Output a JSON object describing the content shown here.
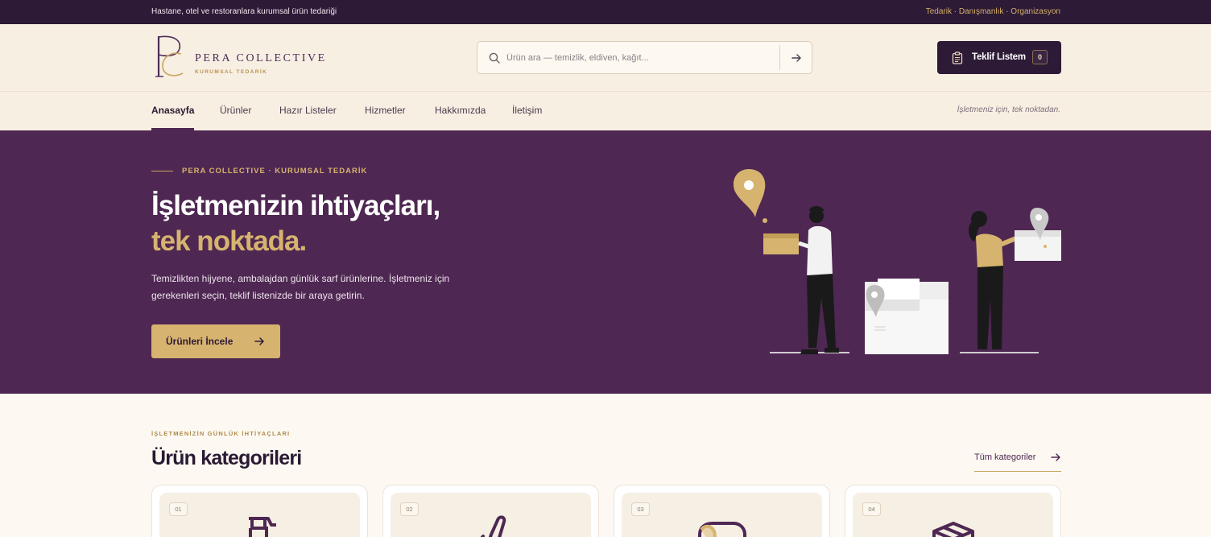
{
  "topbar": {
    "left_text": "Hastane, otel ve restoranlara kurumsal ürün tedariği",
    "right_text": "Tedarik · Danışmanlık · Organizasyon"
  },
  "brand": {
    "name": "PERA COLLECTIVE",
    "subtitle": "KURUMSAL TEDARİK",
    "colors": {
      "plum": "#4e2752",
      "dark": "#2d1a36",
      "gold": "#d6b36e",
      "cream": "#f8efe3"
    }
  },
  "search": {
    "placeholder": "Ürün ara — temizlik, eldiven, kağıt...",
    "value": "",
    "icon": "search-icon",
    "submit_icon": "arrow-right-icon"
  },
  "quote_list": {
    "label": "Teklif Listem",
    "count": "0",
    "icon": "clipboard-icon"
  },
  "nav": {
    "items": [
      {
        "label": "Anasayfa",
        "active": true
      },
      {
        "label": "Ürünler",
        "active": false
      },
      {
        "label": "Hazır Listeler",
        "active": false
      },
      {
        "label": "Hizmetler",
        "active": false
      },
      {
        "label": "Hakkımızda",
        "active": false
      },
      {
        "label": "İletişim",
        "active": false
      }
    ],
    "tagline": "İşletmeniz için, tek noktadan."
  },
  "hero": {
    "eyebrow": "PERA COLLECTIVE · KURUMSAL TEDARİK",
    "title_line1": "İşletmenizin ihtiyaçları,",
    "title_line2": "tek noktada.",
    "description": "Temizlikten hijyene, ambalajdan günlük sarf ürünlerine. İşletmeniz için gerekenleri seçin, teklif listenizde bir araya getirin.",
    "cta_label": "Ürünleri İncele"
  },
  "categories": {
    "eyebrow": "İŞLETMENİZİN GÜNLÜK İHTİYAÇLARI",
    "title": "Ürün kategorileri",
    "all_link": "Tüm kategoriler",
    "cards": [
      {
        "num": "01",
        "icon": "spray-bottle-icon"
      },
      {
        "num": "02",
        "icon": "glove-icon"
      },
      {
        "num": "03",
        "icon": "paper-roll-icon"
      },
      {
        "num": "04",
        "icon": "box-icon"
      }
    ]
  }
}
